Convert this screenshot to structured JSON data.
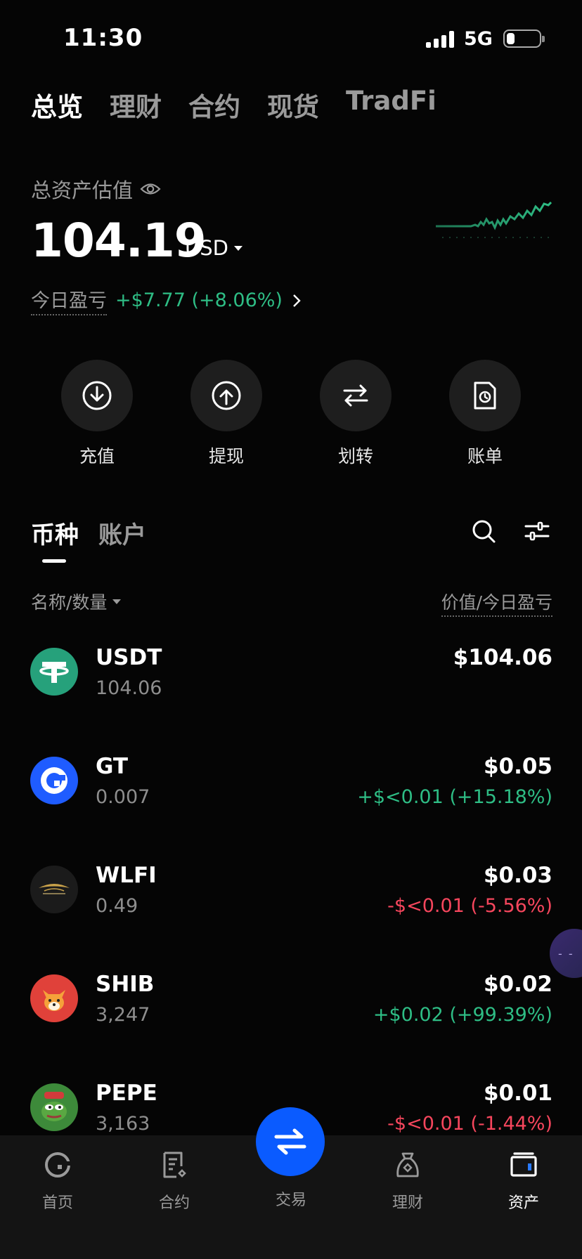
{
  "status_bar": {
    "time": "11:30",
    "network": "5G"
  },
  "top_tabs": [
    "总览",
    "理财",
    "合约",
    "现货",
    "TradFi"
  ],
  "overview": {
    "label": "总资产估值",
    "total": "104.19",
    "currency": "USD",
    "pnl_label": "今日盈亏",
    "pnl_value": "+$7.77 (+8.06%)"
  },
  "actions": [
    {
      "label": "充值",
      "icon": "deposit-icon"
    },
    {
      "label": "提现",
      "icon": "withdraw-icon"
    },
    {
      "label": "划转",
      "icon": "transfer-icon"
    },
    {
      "label": "账单",
      "icon": "bill-icon"
    }
  ],
  "list_tabs": [
    "币种",
    "账户"
  ],
  "columns": {
    "left": "名称/数量",
    "right": "价值/今日盈亏"
  },
  "assets": [
    {
      "symbol": "USDT",
      "qty": "104.06",
      "value": "$104.06",
      "pnl": "",
      "trend": "none"
    },
    {
      "symbol": "GT",
      "qty": "0.007",
      "value": "$0.05",
      "pnl": "+$<0.01 (+15.18%)",
      "trend": "up"
    },
    {
      "symbol": "WLFI",
      "qty": "0.49",
      "value": "$0.03",
      "pnl": "-$<0.01 (-5.56%)",
      "trend": "down"
    },
    {
      "symbol": "SHIB",
      "qty": "3,247",
      "value": "$0.02",
      "pnl": "+$0.02 (+99.39%)",
      "trend": "up"
    },
    {
      "symbol": "PEPE",
      "qty": "3,163",
      "value": "$0.01",
      "pnl": "-$<0.01 (-1.44%)",
      "trend": "down"
    }
  ],
  "bottom_nav": {
    "home": "首页",
    "futures": "合约",
    "trade": "交易",
    "earn": "理财",
    "assets": "资产"
  },
  "colors": {
    "up": "#2ebd85",
    "down": "#f6465d",
    "accent": "#0a5bff",
    "background": "#050505"
  }
}
